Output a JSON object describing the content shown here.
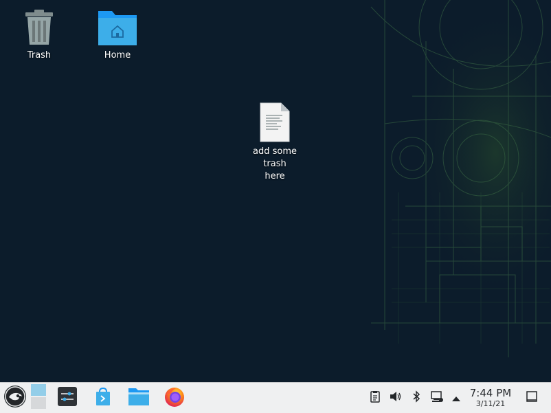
{
  "desktop": {
    "icons": [
      {
        "label": "Trash",
        "icon": "trash-icon"
      },
      {
        "label": "Home",
        "icon": "home-folder-icon"
      },
      {
        "label_line1": "add some trash",
        "label_line2": "here",
        "icon": "text-document-icon"
      }
    ]
  },
  "taskbar": {
    "launcher": {
      "icon": "opensuse-launcher-icon"
    },
    "pager": {
      "icon": "virtual-desktop-pager-icon"
    },
    "apps": [
      {
        "icon": "system-settings-icon"
      },
      {
        "icon": "discover-store-icon"
      },
      {
        "icon": "dolphin-file-manager-icon"
      },
      {
        "icon": "firefox-icon"
      }
    ],
    "tray": [
      {
        "icon": "clipboard-icon"
      },
      {
        "icon": "volume-icon"
      },
      {
        "icon": "bluetooth-icon"
      },
      {
        "icon": "network-icon"
      },
      {
        "icon": "expand-tray-arrow-icon"
      }
    ],
    "clock": {
      "time": "7:44 PM",
      "date": "3/11/21"
    },
    "show_desktop": {
      "icon": "show-desktop-icon"
    }
  },
  "colors": {
    "desktop_bg": "#0c1c2b",
    "wallpaper_lines": "#3a6a3a",
    "taskbar_bg": "#eff0f1",
    "folder_blue": "#3daee9"
  }
}
